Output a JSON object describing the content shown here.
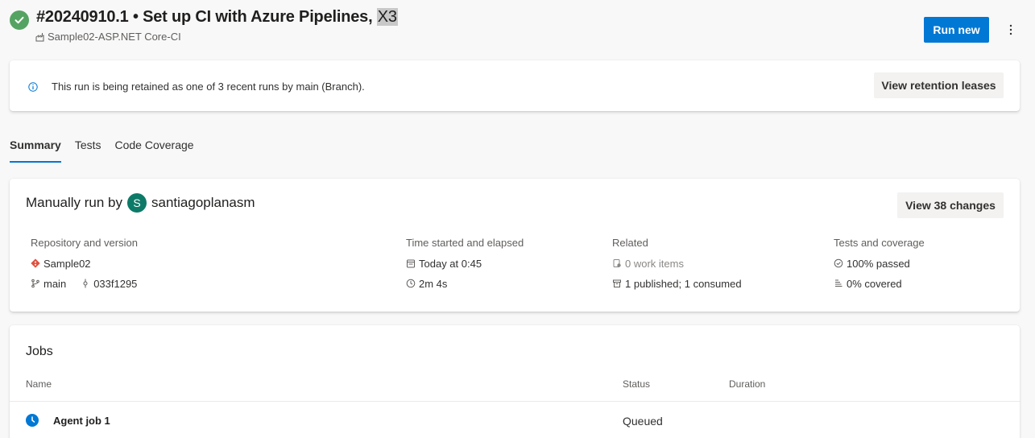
{
  "header": {
    "run_title": "#20240910.1 • Set up CI with Azure Pipelines, ",
    "run_title_highlight": "X3",
    "pipeline_name": "Sample02-ASP.NET Core-CI",
    "run_new_label": "Run new"
  },
  "banner": {
    "message": "This run is being retained as one of 3 recent runs by main (Branch).",
    "button_label": "View retention leases"
  },
  "tabs": [
    {
      "label": "Summary",
      "active": true
    },
    {
      "label": "Tests",
      "active": false
    },
    {
      "label": "Code Coverage",
      "active": false
    }
  ],
  "summary": {
    "run_by_prefix": "Manually run by",
    "avatar_initial": "S",
    "user": "santiagoplanasm",
    "view_changes_label": "View 38 changes",
    "repository": {
      "label": "Repository and version",
      "repo": "Sample02",
      "branch": "main",
      "commit": "033f1295"
    },
    "time": {
      "label": "Time started and elapsed",
      "started": "Today at 0:45",
      "elapsed": "2m 4s"
    },
    "related": {
      "label": "Related",
      "work_items": "0 work items",
      "artifacts": "1 published; 1 consumed"
    },
    "tests": {
      "label": "Tests and coverage",
      "passed": "100% passed",
      "covered": "0% covered"
    }
  },
  "jobs": {
    "title": "Jobs",
    "columns": {
      "name": "Name",
      "status": "Status",
      "duration": "Duration"
    },
    "rows": [
      {
        "name": "Agent job 1",
        "status": "Queued",
        "duration": ""
      }
    ]
  },
  "colors": {
    "accent": "#0078d4",
    "success": "#55a362",
    "avatar": "#0d7a68",
    "repo_icon": "#e0503e"
  }
}
